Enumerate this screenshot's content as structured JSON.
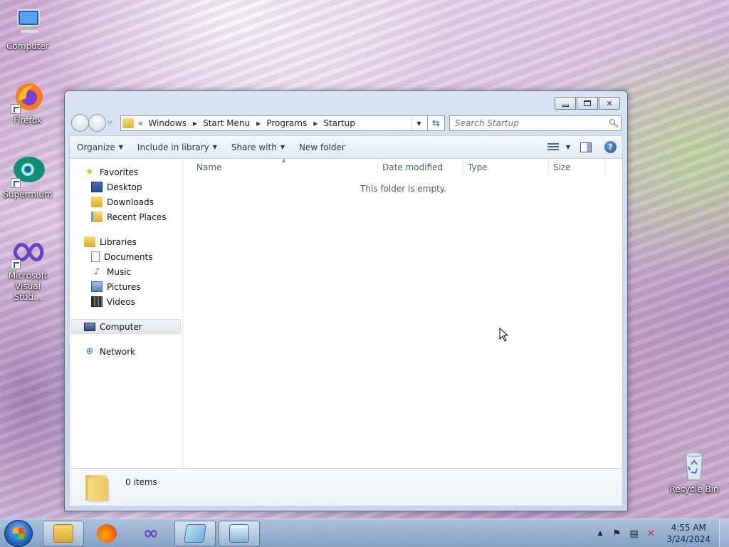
{
  "desktop": {
    "icons": [
      {
        "label": "Computer",
        "icon": "computer-icon"
      },
      {
        "label": "Firefox",
        "icon": "firefox-icon"
      },
      {
        "label": "Supermium",
        "icon": "supermium-icon"
      },
      {
        "label": "Microsoft Visual Stud...",
        "icon": "visual-studio-icon"
      },
      {
        "label": "Recycle Bin",
        "icon": "recycle-bin-icon"
      }
    ]
  },
  "window": {
    "breadcrumb": {
      "overflow": "«",
      "items": [
        "Windows",
        "Start Menu",
        "Programs",
        "Startup"
      ]
    },
    "search_placeholder": "Search Startup",
    "toolbar": {
      "organize": "Organize",
      "include_in_library": "Include in library",
      "share_with": "Share with",
      "new_folder": "New folder"
    },
    "nav": {
      "favorites": {
        "label": "Favorites",
        "items": [
          "Desktop",
          "Downloads",
          "Recent Places"
        ]
      },
      "libraries": {
        "label": "Libraries",
        "items": [
          "Documents",
          "Music",
          "Pictures",
          "Videos"
        ]
      },
      "computer": "Computer",
      "network": "Network"
    },
    "columns": [
      "Name",
      "Date modified",
      "Type",
      "Size"
    ],
    "empty_message": "This folder is empty.",
    "details": {
      "item_count": "0 items"
    }
  },
  "taskbar": {
    "pinned": [
      "windows-explorer-icon",
      "firefox-icon",
      "visual-studio-icon",
      "notepad-icon",
      "control-panel-icon"
    ],
    "clock": {
      "time": "4:55 AM",
      "date": "3/24/2024"
    }
  },
  "colors": {
    "taskbar": "#86a6c9",
    "window_frame": "#cfdcec",
    "link_text": "#1e395b"
  }
}
